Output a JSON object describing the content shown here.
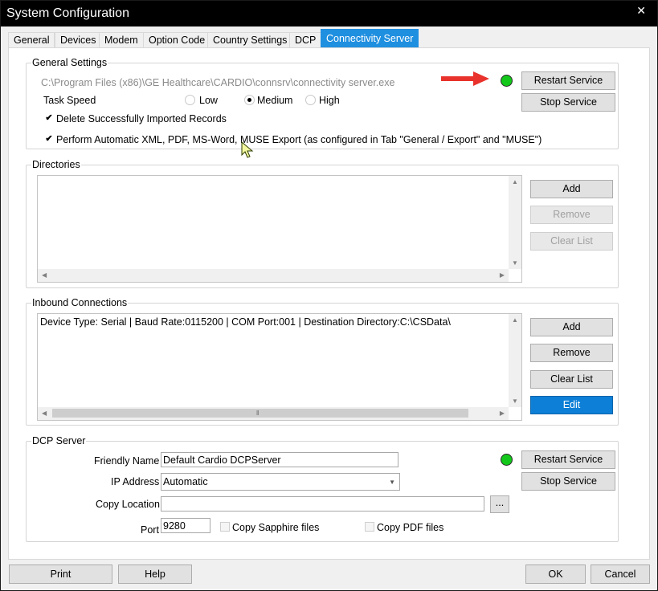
{
  "window": {
    "title": "System Configuration",
    "close_glyph": "✕"
  },
  "tabs": [
    "General",
    "Devices",
    "Modem",
    "Option Code",
    "Country Settings",
    "DCP",
    "Connectivity Server"
  ],
  "active_tab": "Connectivity Server",
  "general_settings": {
    "title": "General Settings",
    "path": "C:\\Program Files (x86)\\GE Healthcare\\CARDIO\\connsrv\\connectivity server.exe",
    "task_speed_label": "Task Speed",
    "speed_options": [
      "Low",
      "Medium",
      "High"
    ],
    "speed_selected": "Medium",
    "delete_imported_label": "Delete Successfully Imported Records",
    "delete_imported_checked": true,
    "auto_export_label": "Perform Automatic XML, PDF, MS-Word, MUSE Export  (as configured in Tab \"General / Export\" and \"MUSE\")",
    "auto_export_checked": true,
    "status": "running",
    "restart_label": "Restart Service",
    "stop_label": "Stop Service"
  },
  "directories": {
    "title": "Directories",
    "items": [],
    "add_label": "Add",
    "remove_label": "Remove",
    "clear_label": "Clear List"
  },
  "inbound": {
    "title": "Inbound Connections",
    "items": [
      "Device Type: Serial  |  Baud Rate:0115200  |  COM Port:001  |  Destination Directory:C:\\CSData\\"
    ],
    "add_label": "Add",
    "remove_label": "Remove",
    "clear_label": "Clear List",
    "edit_label": "Edit"
  },
  "dcp_server": {
    "title": "DCP Server",
    "friendly_name_label": "Friendly Name",
    "friendly_name_value": "Default Cardio DCPServer",
    "ip_label": "IP Address",
    "ip_value": "Automatic",
    "copy_location_label": "Copy Location",
    "copy_location_value": "",
    "browse_label": "...",
    "port_label": "Port",
    "port_value": "9280",
    "copy_sapphire_label": "Copy Sapphire files",
    "copy_sapphire_checked": false,
    "copy_pdf_label": "Copy PDF files",
    "copy_pdf_checked": false,
    "status": "running",
    "restart_label": "Restart Service",
    "stop_label": "Stop Service"
  },
  "footer": {
    "print_label": "Print",
    "help_label": "Help",
    "ok_label": "OK",
    "cancel_label": "Cancel"
  },
  "colors": {
    "led": "#13c81a",
    "active_tab": "#1f8fe0",
    "primary_button": "#0d7fd6",
    "arrow": "#e8322b"
  }
}
